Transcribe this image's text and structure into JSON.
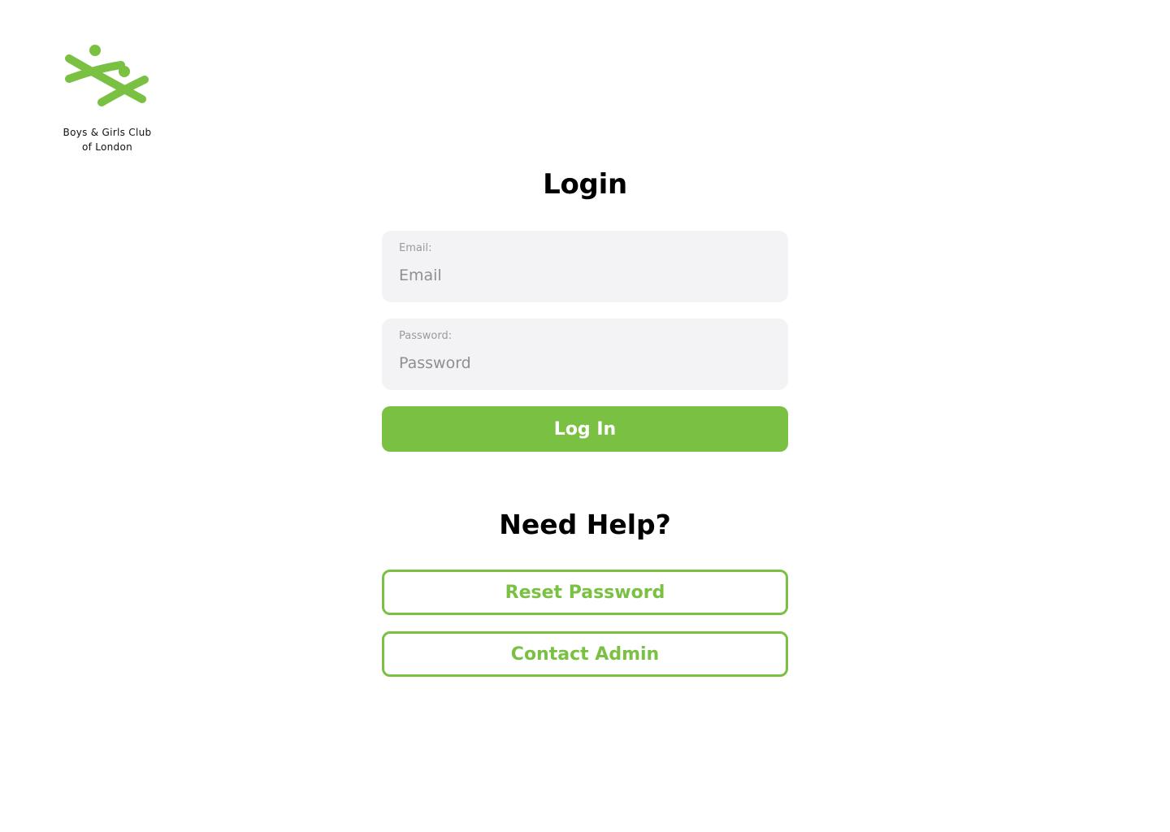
{
  "brand": {
    "logo_icon": "boys-girls-club-logo",
    "name_line1": "Boys & Girls Club",
    "name_line2": "of London",
    "color": "#7ac143"
  },
  "login": {
    "title": "Login",
    "email": {
      "label": "Email:",
      "placeholder": "Email",
      "value": ""
    },
    "password": {
      "label": "Password:",
      "placeholder": "Password",
      "value": ""
    },
    "submit_label": "Log In"
  },
  "help": {
    "title": "Need Help?",
    "reset_label": "Reset Password",
    "contact_label": "Contact Admin"
  },
  "colors": {
    "accent": "#7ac143",
    "field_background": "#f3f3f5",
    "label_text": "#9a9a9f"
  }
}
